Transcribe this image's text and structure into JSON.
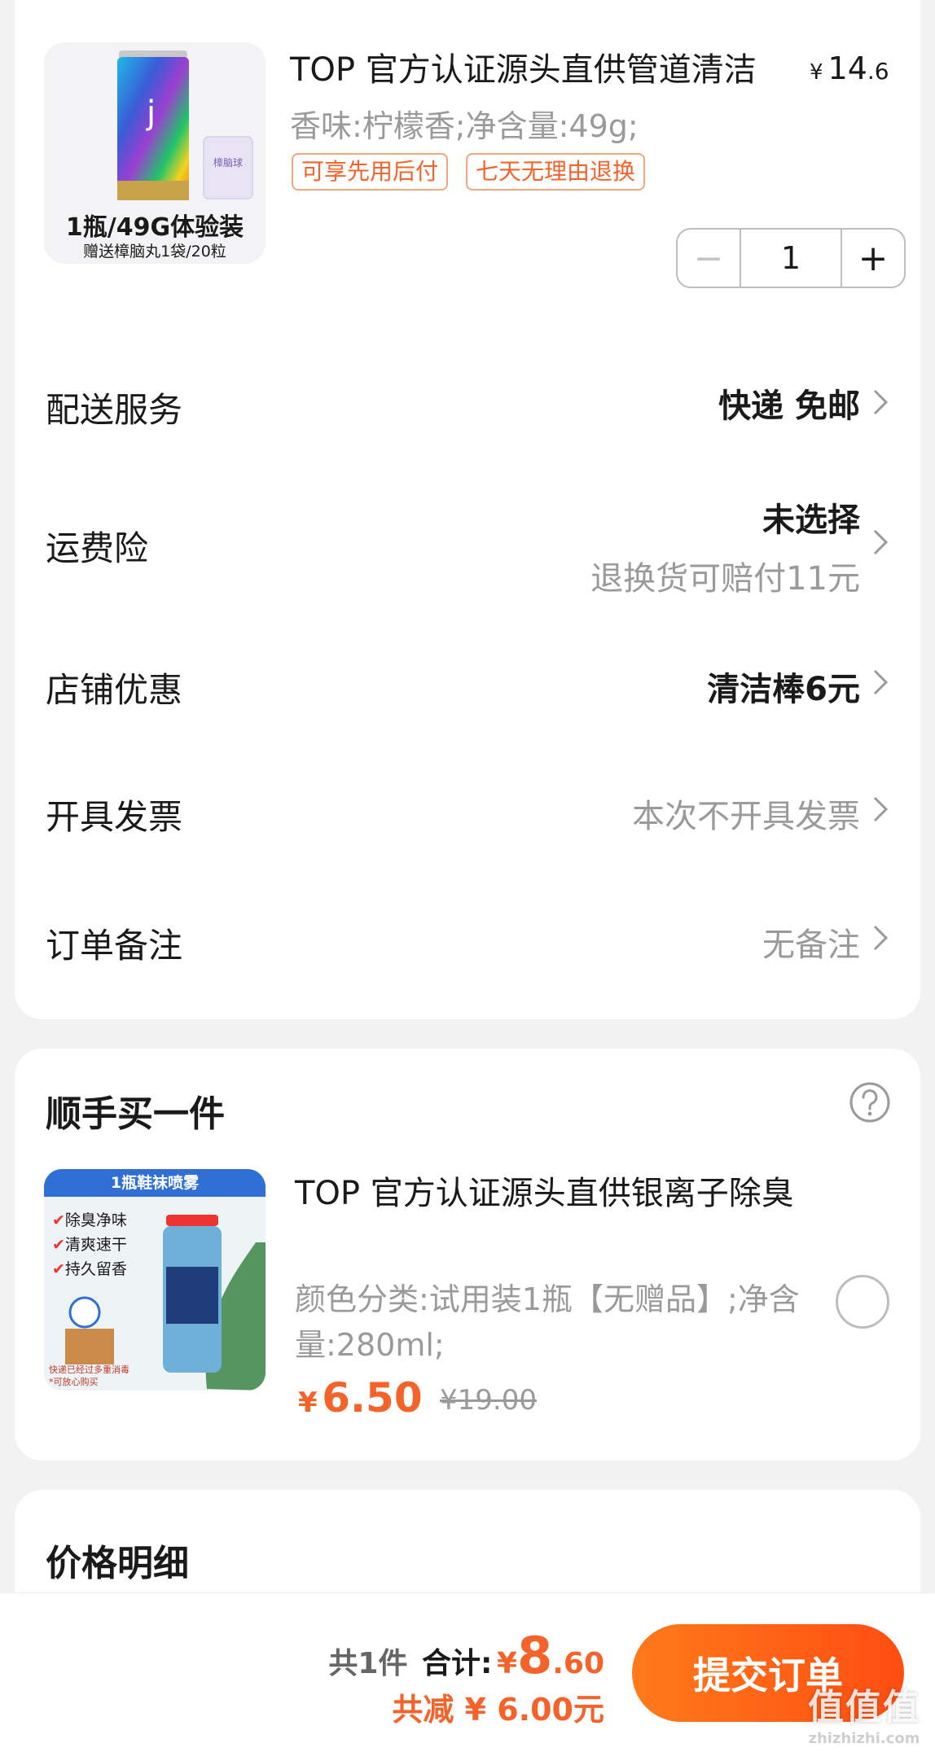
{
  "product": {
    "title": "TOP 官方认证源头直供管道清洁",
    "price_symbol": "¥",
    "price_int": "14",
    "price_dec": ".6",
    "spec": "香味:柠檬香;净含量:49g;",
    "tags": [
      "可享先用后付",
      "七天无理由退换"
    ],
    "image_caption_main": "1瓶/49G体验装",
    "image_caption_sub": "赠送樟脑丸1袋/20粒",
    "image_pack_text": "樟脑球",
    "quantity": "1",
    "minus": "−",
    "plus": "+"
  },
  "rows": [
    {
      "label": "配送服务",
      "value": "快递 免邮"
    },
    {
      "label": "运费险",
      "value": "未选择",
      "sub": "退换货可赔付11元"
    },
    {
      "label": "店铺优惠",
      "value": "清洁棒6元"
    },
    {
      "label": "开具发票",
      "value": "本次不开具发票"
    },
    {
      "label": "订单备注",
      "value": "无备注"
    }
  ],
  "addon": {
    "section_title": "顺手买一件",
    "title": "TOP 官方认证源头直供银离子除臭",
    "spec": "颜色分类:试用装1瓶【无赠品】;净含量:280ml;",
    "price_symbol": "¥",
    "price": "6.50",
    "old_price": "¥19.00",
    "image_banner": "1瓶鞋袜喷雾",
    "image_features": [
      "除臭净味",
      "清爽速干",
      "持久留香"
    ],
    "image_footer": "快递已经过多重消毒",
    "image_footer2": "*可放心购买"
  },
  "price_detail": {
    "title": "价格明细"
  },
  "footer": {
    "count": "共1件",
    "total_label": "合计:",
    "total_symbol": "¥",
    "total_int": "8",
    "total_dec": ".60",
    "discount": "共减 ¥ 6.00元",
    "submit": "提交订单"
  },
  "watermark": {
    "main": "值值值",
    "sub": "zhizhizhi.com"
  },
  "colors": {
    "accent": "#f4632a",
    "button_start": "#ff7a1a",
    "button_end": "#ff4d12",
    "muted": "#9a9a9a"
  },
  "icons": [
    "chevron-right-icon",
    "help-circle-icon",
    "radio-unchecked-icon"
  ]
}
